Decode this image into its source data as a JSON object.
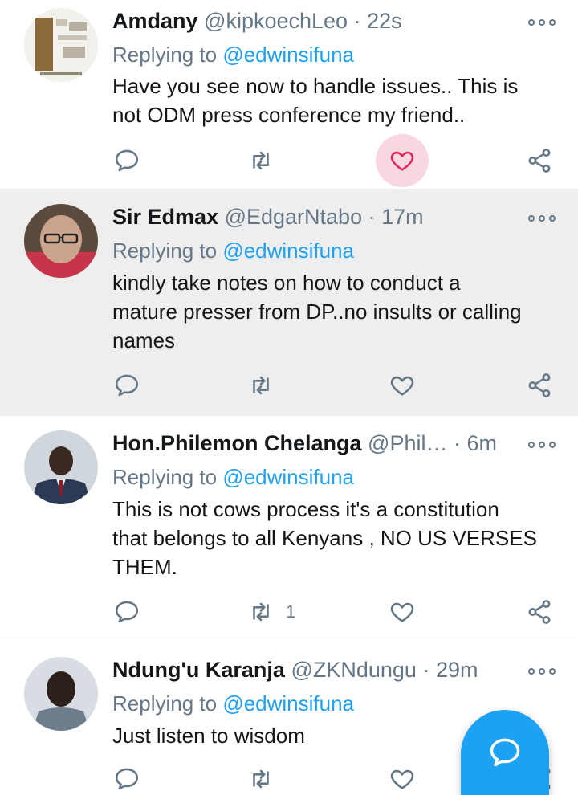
{
  "colors": {
    "accent": "#1da1f2",
    "secondary_text": "#657786",
    "highlight_bg": "#eeeeee",
    "like_active_bg": "#f8d7e1",
    "like_active": "#e0245e"
  },
  "tweets": [
    {
      "name": "Amdany",
      "handle": "@kipkoechLeo",
      "time": "22s",
      "replying_prefix": "Replying to",
      "replying_to": "@edwinsifuna",
      "text_lines": [
        "Have you see now to handle issues.. This is",
        "not ODM press conference my friend.."
      ],
      "retweet_count": "",
      "like_active": true
    },
    {
      "name": "Sir Edmax",
      "handle": "@EdgarNtabo",
      "time": "17m",
      "replying_prefix": "Replying to",
      "replying_to": "@edwinsifuna",
      "text_lines": [
        "kindly take notes on how to conduct a",
        "mature presser from DP..no insults or calling",
        "names"
      ],
      "retweet_count": "",
      "like_active": false
    },
    {
      "name": "Hon.Philemon Chelanga",
      "handle": "@Phil…",
      "time": "6m",
      "replying_prefix": "Replying to",
      "replying_to": "@edwinsifuna",
      "text_lines": [
        "This is not cows process it's a constitution",
        "that belongs to all Kenyans , NO US VERSES",
        "THEM."
      ],
      "retweet_count": "1",
      "like_active": false
    },
    {
      "name": "Ndung'u Karanja",
      "handle": "@ZKNdungu",
      "time": "29m",
      "replying_prefix": "Replying to",
      "replying_to": "@edwinsifuna",
      "text_lines": [
        "Just listen to wisdom"
      ],
      "retweet_count": "",
      "like_active": false
    }
  ],
  "separator": "·",
  "icons": {
    "reply": "reply-icon",
    "retweet": "retweet-icon",
    "like": "heart-icon",
    "share": "share-icon",
    "more": "more-options-icon",
    "compose": "compose-reply-icon"
  }
}
